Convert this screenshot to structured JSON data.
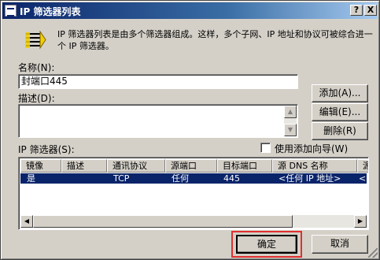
{
  "window": {
    "title": "IP 筛选器列表",
    "help_label": "?",
    "close_label": "X"
  },
  "description": "IP 筛选器列表是由多个筛选器组成。这样，多个子网、IP 地址和协议可被综合进一个 IP 筛选器。",
  "name_field": {
    "label": "名称(N):",
    "value": "封端口445"
  },
  "desc_field": {
    "label": "描述(D):",
    "value": ""
  },
  "buttons": {
    "add": "添加(A)...",
    "edit": "编辑(E)...",
    "remove": "删除(R)",
    "ok": "确定",
    "cancel": "取消"
  },
  "filters": {
    "label": "IP 筛选器(S):",
    "wizard_label": "使用添加向导(W)",
    "wizard_checked": false,
    "columns": [
      "镜像",
      "描述",
      "通讯协议",
      "源端口",
      "目标端口",
      "源 DNS 名称",
      "源"
    ],
    "rows": [
      [
        "是",
        "",
        "TCP",
        "任何",
        "445",
        "<任何 IP 地址>",
        "<"
      ]
    ]
  },
  "colors": {
    "title_bar": "#0a246a",
    "selection": "#0a246a",
    "highlight_border": "#e03030"
  }
}
